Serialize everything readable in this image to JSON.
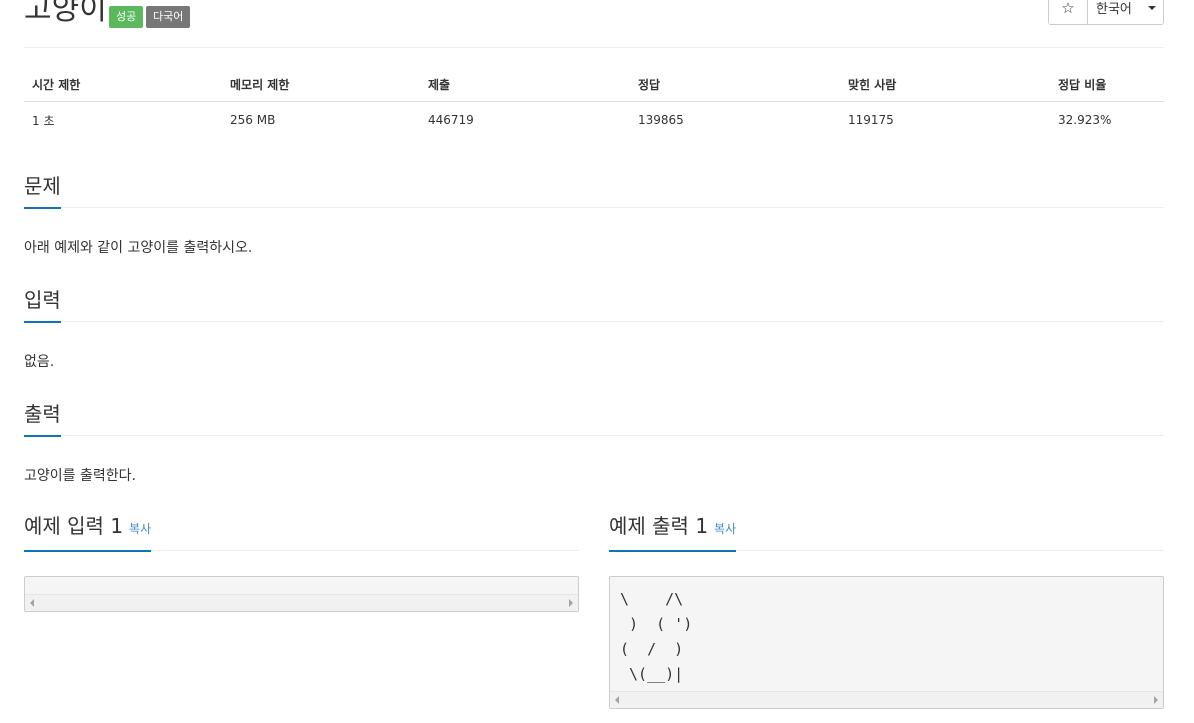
{
  "problem": {
    "title": "고양이",
    "labels": {
      "success": "성공",
      "multilang": "다국어"
    }
  },
  "toolbar": {
    "star_glyph": "☆",
    "language": "한국어"
  },
  "stats": {
    "headers": [
      "시간 제한",
      "메모리 제한",
      "제출",
      "정답",
      "맞힌 사람",
      "정답 비율"
    ],
    "values": [
      "1 초",
      "256 MB",
      "446719",
      "139865",
      "119175",
      "32.923%"
    ]
  },
  "sections": {
    "description": {
      "heading": "문제",
      "text": "아래 예제와 같이 고양이를 출력하시오."
    },
    "input": {
      "heading": "입력",
      "text": "없음."
    },
    "output": {
      "heading": "출력",
      "text": "고양이를 출력한다."
    }
  },
  "samples": {
    "input": {
      "heading": "예제 입력 1",
      "copy_label": "복사",
      "content": ""
    },
    "output": {
      "heading": "예제 출력 1",
      "copy_label": "복사",
      "content": "\\    /\\\n )  ( ')\n(  /  )\n \\(__)|"
    }
  },
  "colors": {
    "accent": "#0e76b8",
    "success": "#5cb85c",
    "default_label": "#777777",
    "link": "#428bca"
  }
}
